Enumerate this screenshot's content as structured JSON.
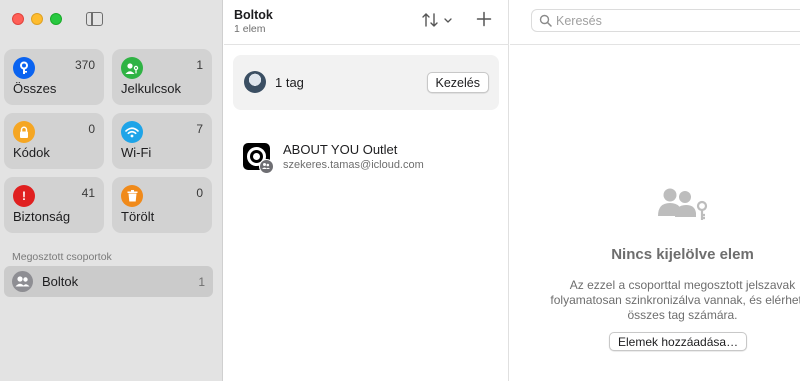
{
  "colors": {
    "all": "#0a63f0",
    "keys": "#2fb344",
    "codes": "#f5a623",
    "wifi": "#1ea4e8",
    "security": "#e02020",
    "deleted": "#f08a1a"
  },
  "sidebar": {
    "tiles": [
      {
        "label": "Összes",
        "count": "370",
        "icon": "key-icon"
      },
      {
        "label": "Jelkulcsok",
        "count": "1",
        "icon": "person-key-icon"
      },
      {
        "label": "Kódok",
        "count": "0",
        "icon": "lock-clock-icon"
      },
      {
        "label": "Wi-Fi",
        "count": "7",
        "icon": "wifi-icon"
      },
      {
        "label": "Biztonság",
        "count": "41",
        "icon": "exclamation-icon"
      },
      {
        "label": "Törölt",
        "count": "0",
        "icon": "trash-icon"
      }
    ],
    "section_label": "Megosztott csoportok",
    "groups": [
      {
        "label": "Boltok",
        "count": "1",
        "icon": "group-icon"
      }
    ]
  },
  "list": {
    "title": "Boltok",
    "subtitle": "1 elem",
    "member_label": "1 tag",
    "manage_label": "Kezelés",
    "entries": [
      {
        "title": "ABOUT YOU Outlet",
        "subtitle": "szekeres.tamas@icloud.com",
        "icon": "about-you-logo-icon"
      }
    ]
  },
  "detail": {
    "search_placeholder": "Keresés",
    "empty_title": "Nincs kijelölve elem",
    "empty_line1": "Az ezzel a csoporttal megosztott jelszavak",
    "empty_line2": "folyamatosan szinkronizálva vannak, és elérhetők",
    "empty_line3": "összes tag számára.",
    "add_items_label": "Elemek hozzáadása…"
  }
}
